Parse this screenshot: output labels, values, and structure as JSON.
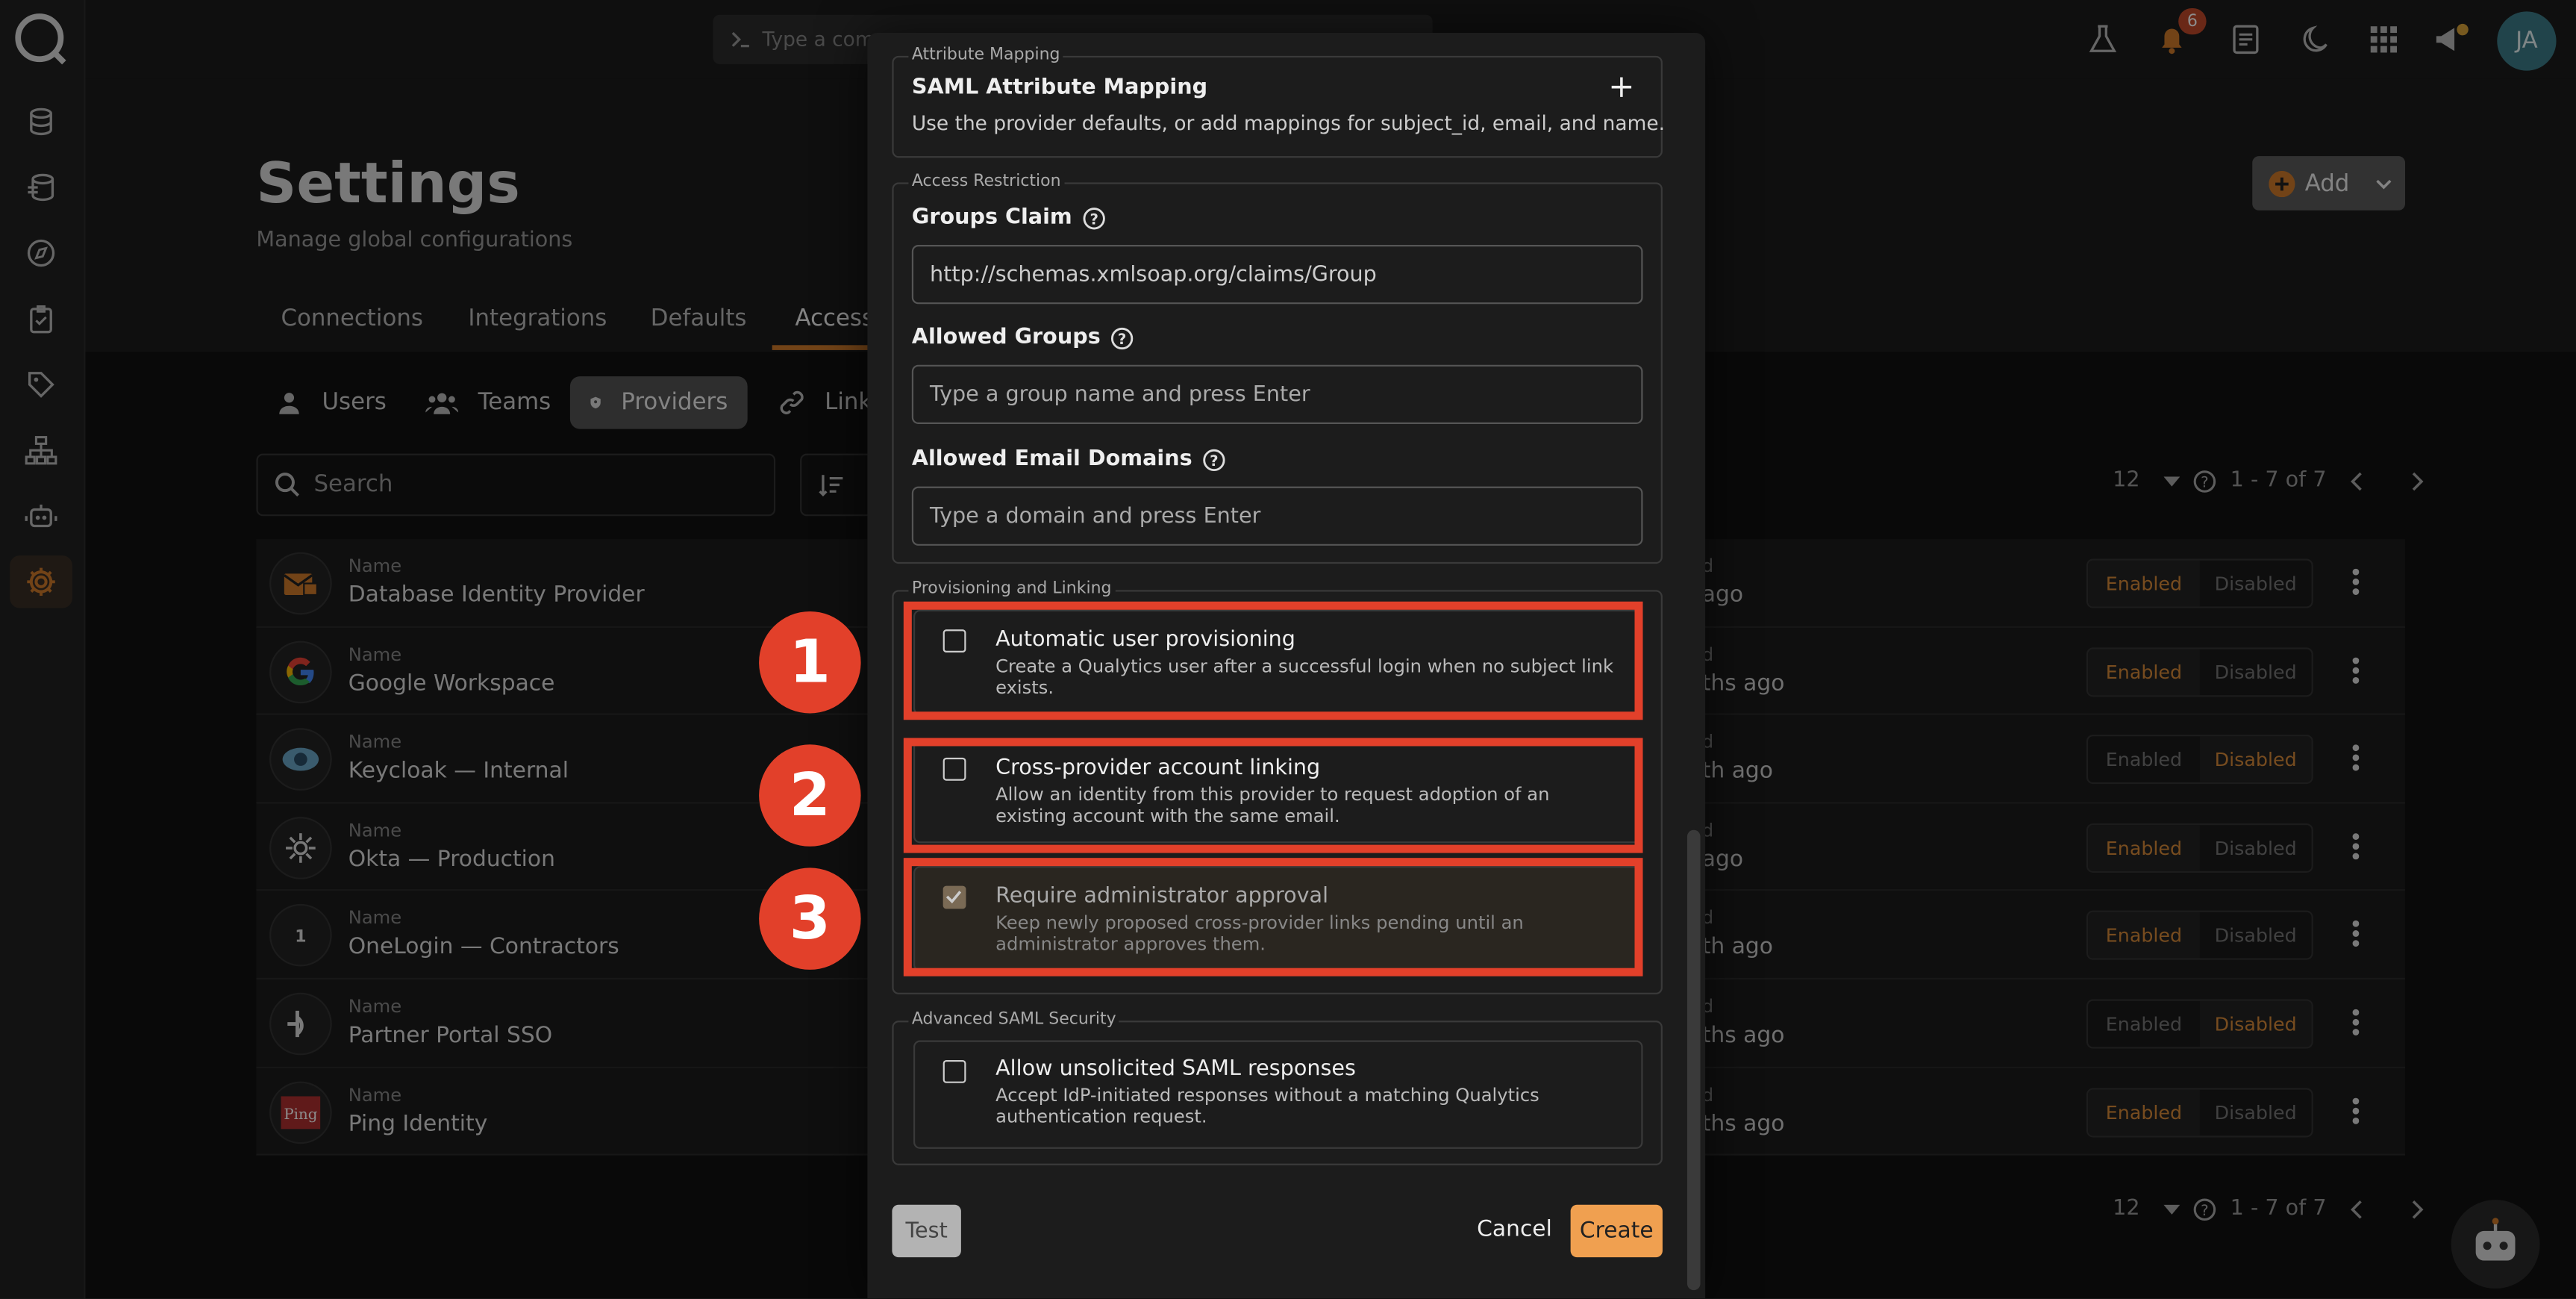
{
  "topbar": {
    "command_placeholder": "Type a comm",
    "notifications_count": "6",
    "avatar_initials": "JA"
  },
  "page": {
    "title": "Settings",
    "subtitle": "Manage global configurations",
    "add_label": "Add"
  },
  "tabs": [
    "Connections",
    "Integrations",
    "Defaults",
    "Access"
  ],
  "subtabs": [
    "Users",
    "Teams",
    "Providers",
    "Link"
  ],
  "search": {
    "placeholder": "Search"
  },
  "pager": {
    "page_size": "12",
    "range": "1 - 7 of 7"
  },
  "providers": [
    {
      "label": "Name",
      "name": "Database Identity Provider",
      "updated_label": "d",
      "updated": "ago",
      "status": "Enabled"
    },
    {
      "label": "Name",
      "name": "Google Workspace",
      "updated_label": "d",
      "updated": "ths ago",
      "status": "Enabled"
    },
    {
      "label": "Name",
      "name": "Keycloak — Internal",
      "updated_label": "d",
      "updated": "th ago",
      "status": "Disabled"
    },
    {
      "label": "Name",
      "name": "Okta — Production",
      "updated_label": "d",
      "updated": "ago",
      "status": "Enabled"
    },
    {
      "label": "Name",
      "name": "OneLogin — Contractors",
      "updated_label": "d",
      "updated": "th ago",
      "status": "Enabled"
    },
    {
      "label": "Name",
      "name": "Partner Portal SSO",
      "updated_label": "d",
      "updated": "ths ago",
      "status": "Disabled"
    },
    {
      "label": "Name",
      "name": "Ping Identity",
      "updated_label": "d",
      "updated": "ths ago",
      "status": "Enabled"
    }
  ],
  "toggle": {
    "enabled": "Enabled",
    "disabled": "Disabled"
  },
  "modal": {
    "attribute_mapping": {
      "legend": "Attribute Mapping",
      "title": "SAML Attribute Mapping",
      "desc": "Use the provider defaults, or add mappings for subject_id, email, and name."
    },
    "access_restriction": {
      "legend": "Access Restriction",
      "groups_claim_label": "Groups Claim",
      "groups_claim_value": "http://schemas.xmlsoap.org/claims/Group",
      "allowed_groups_label": "Allowed Groups",
      "allowed_groups_placeholder": "Type a group name and press Enter",
      "allowed_domains_label": "Allowed Email Domains",
      "allowed_domains_placeholder": "Type a domain and press Enter"
    },
    "provisioning": {
      "legend": "Provisioning and Linking",
      "items": [
        {
          "title": "Automatic user provisioning",
          "desc": "Create a Qualytics user after a successful login when no subject link exists.",
          "checked": false
        },
        {
          "title": "Cross-provider account linking",
          "desc": "Allow an identity from this provider to request adoption of an existing account with the same email.",
          "checked": false
        },
        {
          "title": "Require administrator approval",
          "desc": "Keep newly proposed cross-provider links pending until an administrator approves them.",
          "checked": true,
          "disabled": true
        }
      ]
    },
    "advanced": {
      "legend": "Advanced SAML Security",
      "title": "Allow unsolicited SAML responses",
      "desc": "Accept IdP-initiated responses without a matching Qualytics authentication request."
    },
    "buttons": {
      "test": "Test",
      "cancel": "Cancel",
      "create": "Create"
    }
  },
  "markers": [
    "1",
    "2",
    "3"
  ],
  "colors": {
    "accent": "#d07a2a",
    "annotation": "#e2402a",
    "create": "#f0a050"
  }
}
